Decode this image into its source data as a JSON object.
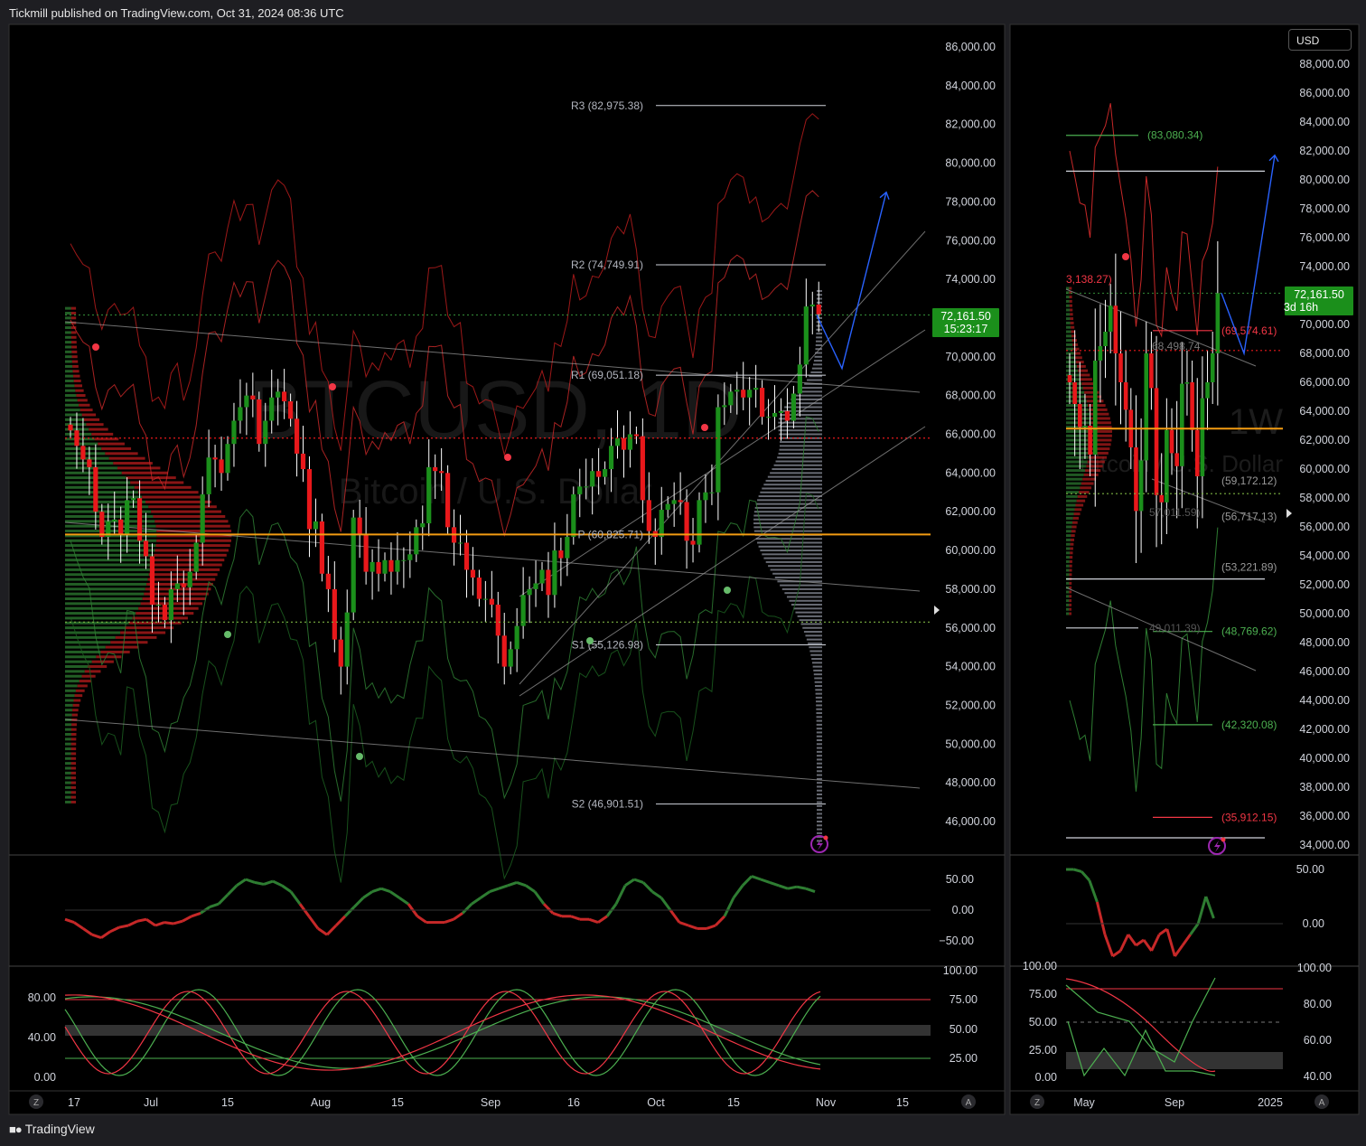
{
  "header": {
    "published": "Tickmill published on TradingView.com, Oct 31, 2024 08:36 UTC"
  },
  "footer": {
    "brand": "TradingView"
  },
  "colors": {
    "bull": "#1b8f1b",
    "bear": "#e8181b",
    "pivot": "#f39c12",
    "background": "#000000",
    "accent_blue": "#2962ff"
  },
  "left_chart": {
    "watermark_symbol": "BTCUSD, 1D",
    "watermark_name": "Bitcoin / U.S. Dollar",
    "price_badge": {
      "price": "72,161.50",
      "countdown": "15:23:17"
    },
    "y_ticks": [
      "86,000.00",
      "84,000.00",
      "82,000.00",
      "80,000.00",
      "78,000.00",
      "76,000.00",
      "74,000.00",
      "72,000.00",
      "70,000.00",
      "68,000.00",
      "66,000.00",
      "64,000.00",
      "62,000.00",
      "60,000.00",
      "58,000.00",
      "56,000.00",
      "54,000.00",
      "52,000.00",
      "50,000.00",
      "48,000.00",
      "46,000.00"
    ],
    "x_ticks": [
      "17",
      "Jul",
      "15",
      "Aug",
      "15",
      "Sep",
      "16",
      "Oct",
      "15",
      "Nov",
      "15"
    ],
    "pivots": [
      "R3 (82,975.38)",
      "R2 (74,749.91)",
      "R1 (69,051.18)",
      "P (60,825.71)",
      "S1 (55,126.98)",
      "S2 (46,901.51)"
    ],
    "osc1_ticks": [
      "50.00",
      "0.00",
      "−50.00"
    ],
    "osc2_left_ticks": [
      "80.00",
      "40.00",
      "0.00"
    ],
    "osc2_right_ticks": [
      "100.00",
      "75.00",
      "50.00",
      "25.00"
    ],
    "corner_labels": {
      "z": "Z",
      "a": "A"
    }
  },
  "right_chart": {
    "currency": "USD",
    "watermark_interval": "1W",
    "watermark_name": "Bitcoin / U.S. Dollar",
    "price_badge": {
      "price": "72,161.50",
      "countdown": "3d 16h"
    },
    "y_ticks": [
      "88,000.00",
      "86,000.00",
      "84,000.00",
      "82,000.00",
      "80,000.00",
      "78,000.00",
      "76,000.00",
      "74,000.00",
      "72,000.00",
      "70,000.00",
      "68,000.00",
      "66,000.00",
      "64,000.00",
      "62,000.00",
      "60,000.00",
      "58,000.00",
      "56,000.00",
      "54,000.00",
      "52,000.00",
      "50,000.00",
      "48,000.00",
      "46,000.00",
      "44,000.00",
      "42,000.00",
      "40,000.00",
      "38,000.00",
      "36,000.00",
      "34,000.00"
    ],
    "x_ticks": [
      "May",
      "Sep",
      "2025"
    ],
    "labels": [
      "(83,080.34)",
      "(69,574.61)",
      "68,498.74",
      "(59,172.12)",
      "(56,717.13)",
      "(53,221.89)",
      "(48,769.62)",
      "(42,320.08)",
      "(35,912.15)",
      "3,138.27)",
      "49,011.39)",
      "57,011.59)"
    ],
    "osc1_ticks": [
      "50.00",
      "0.00"
    ],
    "osc2_left_ticks": [
      "100.00",
      "75.00",
      "50.00",
      "25.00",
      "0.00"
    ],
    "osc2_right_ticks": [
      "100.00",
      "80.00",
      "60.00",
      "40.00"
    ],
    "corner_labels": {
      "z": "Z",
      "a": "A"
    }
  },
  "chart_data": [
    {
      "type": "candlestick",
      "title": "BTCUSD, 1D",
      "subtitle": "Bitcoin / U.S. Dollar",
      "interval": "1D",
      "ylim": [
        45000,
        87000
      ],
      "x_ticks": [
        "17",
        "Jul",
        "15",
        "Aug",
        "15",
        "Sep",
        "16",
        "Oct",
        "15",
        "Nov",
        "15"
      ],
      "last_price": 72161.5,
      "close_series_approx": [
        66200,
        65400,
        64700,
        64300,
        62000,
        60700,
        61500,
        61600,
        60800,
        62600,
        62700,
        60500,
        59700,
        57200,
        57200,
        56400,
        58000,
        58300,
        58100,
        58900,
        60400,
        62900,
        64800,
        64700,
        64000,
        65500,
        66700,
        67400,
        68000,
        67800,
        65500,
        66700,
        67900,
        68200,
        67700,
        66800,
        65000,
        64200,
        61100,
        61500,
        58800,
        58000,
        55400,
        54000,
        56800,
        61700,
        60800,
        58900,
        59400,
        58800,
        59500,
        58900,
        59500,
        59500,
        59800,
        61200,
        61400,
        64300,
        64100,
        64000,
        61200,
        60400,
        60400,
        59000,
        58600,
        57500,
        57500,
        57200,
        55600,
        54000,
        54900,
        56100,
        57700,
        58000,
        58300,
        59000,
        57700,
        60000,
        59600,
        60700,
        62900,
        63300,
        63300,
        64100,
        63800,
        64200,
        65400,
        65800,
        65200,
        66000,
        65900,
        62600,
        61000,
        60700,
        62100,
        62400,
        62600,
        62500,
        60500,
        60300,
        62600,
        63000,
        63000,
        67400,
        67500,
        68200,
        68300,
        67900,
        68300,
        68400,
        66900,
        66900,
        67100,
        67200,
        66700,
        68100,
        69600,
        72600,
        72700,
        72200
      ],
      "pivots": {
        "R3": 82975.38,
        "R2": 74749.91,
        "R1": 69051.18,
        "P": 60825.71,
        "S1": 55126.98,
        "S2": 46901.51
      },
      "projection": [
        72161.5,
        69400,
        78500
      ]
    },
    {
      "type": "candlestick",
      "title": "1W",
      "subtitle": "Bitcoin / U.S. Dollar",
      "interval": "1W",
      "ylim": [
        33500,
        89500
      ],
      "x_ticks": [
        "May",
        "Sep",
        "2025"
      ],
      "last_price": 72161.5,
      "close_series_approx": [
        66000,
        64500,
        62900,
        63000,
        61000,
        67500,
        68500,
        69500,
        71300,
        68000,
        66000,
        64100,
        61500,
        57100,
        60600,
        68000,
        65600,
        58200,
        57700,
        62700,
        61100,
        60200,
        65900,
        66000,
        62700,
        59500,
        64900,
        66000,
        68000,
        72161.5
      ],
      "levels": [
        83080.34,
        69574.61,
        68498.74,
        59172.12,
        56717.13,
        53221.89,
        48769.62,
        42320.08,
        35912.15
      ],
      "projection": [
        72161.5,
        68000,
        81700
      ]
    }
  ]
}
